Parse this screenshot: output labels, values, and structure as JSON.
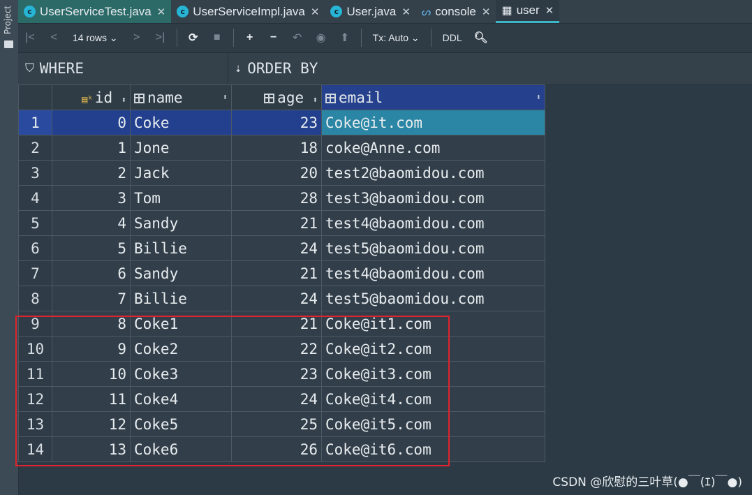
{
  "side": {
    "label": "Project"
  },
  "tabs": [
    {
      "label": "UserServiceTest.java",
      "icon": "class-c-icon"
    },
    {
      "label": "UserServiceImpl.java",
      "icon": "class-c-icon"
    },
    {
      "label": "User.java",
      "icon": "class-c-icon"
    },
    {
      "label": "console",
      "icon": "console-icon"
    },
    {
      "label": "user",
      "icon": "table-icon"
    }
  ],
  "toolbar": {
    "rows_label": "14 rows",
    "tx_label": "Tx: Auto",
    "ddl_label": "DDL"
  },
  "filter": {
    "where_label": "WHERE",
    "orderby_label": "ORDER BY"
  },
  "columns": [
    "id",
    "name",
    "age",
    "email"
  ],
  "rows": [
    {
      "n": "1",
      "id": "0",
      "name": "Coke",
      "age": "23",
      "email": "Coke@it.com"
    },
    {
      "n": "2",
      "id": "1",
      "name": "Jone",
      "age": "18",
      "email": "coke@Anne.com"
    },
    {
      "n": "3",
      "id": "2",
      "name": "Jack",
      "age": "20",
      "email": "test2@baomidou.com"
    },
    {
      "n": "4",
      "id": "3",
      "name": "Tom",
      "age": "28",
      "email": "test3@baomidou.com"
    },
    {
      "n": "5",
      "id": "4",
      "name": "Sandy",
      "age": "21",
      "email": "test4@baomidou.com"
    },
    {
      "n": "6",
      "id": "5",
      "name": "Billie",
      "age": "24",
      "email": "test5@baomidou.com"
    },
    {
      "n": "7",
      "id": "6",
      "name": "Sandy",
      "age": "21",
      "email": "test4@baomidou.com"
    },
    {
      "n": "8",
      "id": "7",
      "name": "Billie",
      "age": "24",
      "email": "test5@baomidou.com"
    },
    {
      "n": "9",
      "id": "8",
      "name": "Coke1",
      "age": "21",
      "email": "Coke@it1.com"
    },
    {
      "n": "10",
      "id": "9",
      "name": "Coke2",
      "age": "22",
      "email": "Coke@it2.com"
    },
    {
      "n": "11",
      "id": "10",
      "name": "Coke3",
      "age": "23",
      "email": "Coke@it3.com"
    },
    {
      "n": "12",
      "id": "11",
      "name": "Coke4",
      "age": "24",
      "email": "Coke@it4.com"
    },
    {
      "n": "13",
      "id": "12",
      "name": "Coke5",
      "age": "25",
      "email": "Coke@it5.com"
    },
    {
      "n": "14",
      "id": "13",
      "name": "Coke6",
      "age": "26",
      "email": "Coke@it6.com"
    }
  ],
  "watermark": "CSDN @欣慰的三叶草(●￣(ｴ)￣●)",
  "colors": {
    "accent": "#3fb6c8",
    "selection": "#23408e",
    "highlight_border": "#e0232d"
  }
}
